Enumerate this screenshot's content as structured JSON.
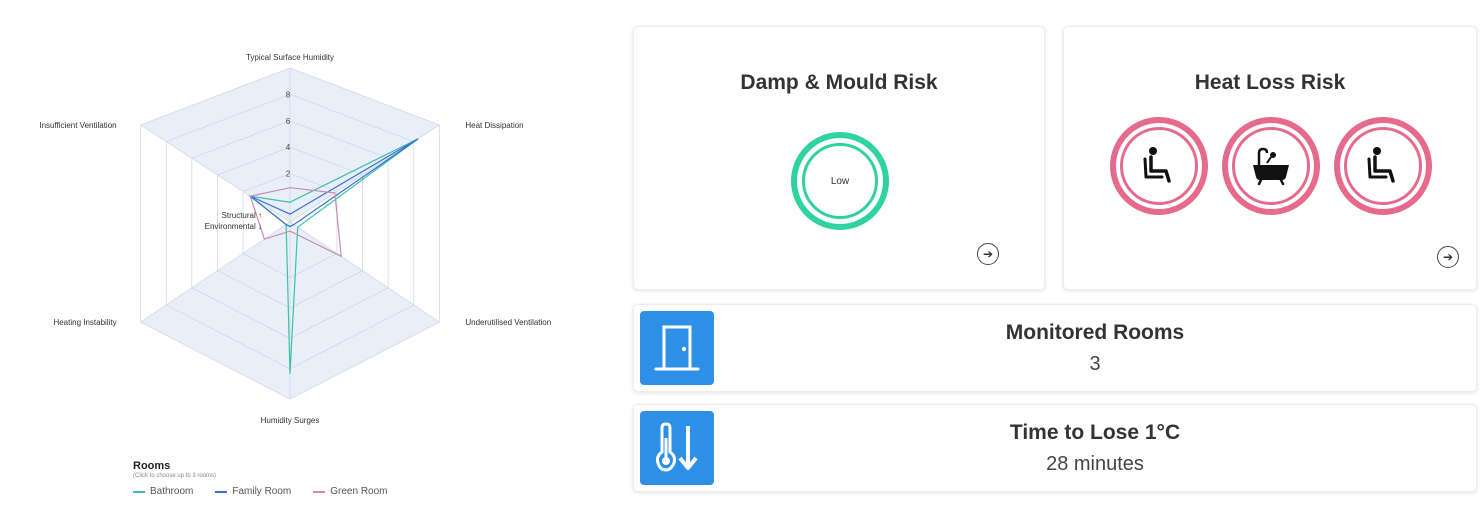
{
  "radar": {
    "axes": [
      "Typical Surface Humidity",
      "Heat Dissipation",
      "Underutilised Ventilation",
      "Humidity Surges",
      "Heating Instability",
      "Insufficient Ventilation"
    ],
    "ticks": [
      "8",
      "6",
      "4",
      "2"
    ],
    "center_labels": [
      "Structural ↑",
      "Environmental ↓"
    ]
  },
  "chart_data": {
    "type": "radar",
    "title": "",
    "categories": [
      "Typical Surface Humidity",
      "Heat Dissipation",
      "Underutilised Ventilation",
      "Humidity Surges",
      "Heating Instability",
      "Insufficient Ventilation"
    ],
    "range": [
      0,
      10
    ],
    "scale_divisions": 5,
    "center_division": "top three axes Structural, bottom three axes Environmental",
    "series": [
      {
        "name": "Bathroom",
        "color": "#3cc0a8",
        "values": [
          1.5,
          10,
          0.6,
          10,
          0.3,
          3.1
        ]
      },
      {
        "name": "Family Room",
        "color": "#3a6fd6",
        "values": [
          0.6,
          10,
          0.3,
          0.3,
          0.3,
          3.1
        ]
      },
      {
        "name": "Green Room",
        "color": "#c98ab4",
        "values": [
          2.6,
          3.5,
          4,
          0.6,
          2,
          3.1
        ]
      }
    ],
    "legend": {
      "title": "Rooms",
      "subtitle": "(Click to choose up to 3 rooms)",
      "position": "bottom-left"
    }
  },
  "legend": {
    "title": "Rooms",
    "subtitle": "(Click to choose up to 3 rooms)",
    "items": [
      "Bathroom",
      "Family Room",
      "Green Room"
    ]
  },
  "damp_card": {
    "title": "Damp & Mould Risk",
    "level": "Low",
    "color": "#2ed3a0",
    "arrow_icon": "arrow-right-circle-icon"
  },
  "heat_card": {
    "title": "Heat Loss Risk",
    "color": "#e66a8c",
    "rooms": [
      "armchair-icon",
      "bathtub-icon",
      "armchair-icon"
    ],
    "arrow_icon": "arrow-right-circle-icon"
  },
  "monitored": {
    "title": "Monitored Rooms",
    "value": "3",
    "icon": "door-icon",
    "color": "#2d8fe6"
  },
  "time_lose": {
    "title": "Time to Lose 1°C",
    "value": "28 minutes",
    "icon": "thermometer-down-icon",
    "color": "#2d8fe6"
  }
}
